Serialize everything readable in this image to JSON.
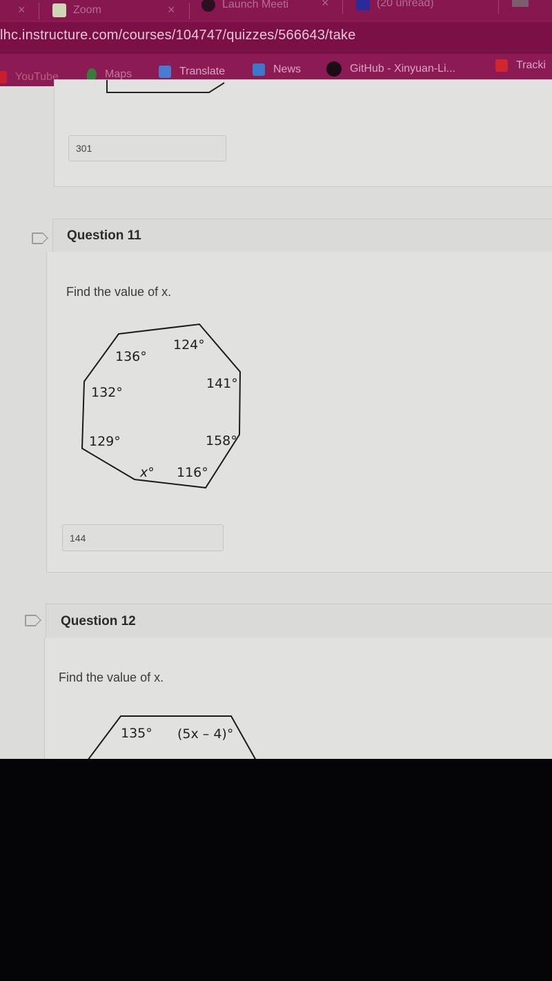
{
  "browser": {
    "tabs": [
      {
        "label": "",
        "close": "×"
      },
      {
        "label": "Zoom",
        "close": "×"
      },
      {
        "label": "Launch Meeti",
        "close": "×"
      },
      {
        "label": "(20 unread)"
      }
    ],
    "url": "lhc.instructure.com/courses/104747/quizzes/566643/take",
    "bookmarks": [
      {
        "label": "YouTube",
        "icon": "youtube-icon"
      },
      {
        "label": "Maps",
        "icon": "maps-icon"
      },
      {
        "label": "Translate",
        "icon": "translate-icon"
      },
      {
        "label": "News",
        "icon": "news-icon"
      },
      {
        "label": "GitHub - Xinyuan-Li...",
        "icon": "github-icon"
      },
      {
        "label": "Tracki",
        "icon": "tracking-icon"
      }
    ]
  },
  "quiz": {
    "previous_question": {
      "answer_value": "301"
    },
    "questions": [
      {
        "title": "Question 11",
        "prompt": "Find the value of x.",
        "figure": {
          "shape": "octagon",
          "angle_labels": [
            "124°",
            "136°",
            "132°",
            "141°",
            "129°",
            "158°",
            "x°",
            "116°"
          ]
        },
        "answer_value": "144"
      },
      {
        "title": "Question 12",
        "prompt": "Find the value of x.",
        "figure": {
          "shape": "polygon",
          "angle_labels": [
            "135°",
            "(5x – 4)°"
          ]
        }
      }
    ]
  },
  "colors": {
    "chrome": "#8c1a55",
    "page_bg": "#dcdcda"
  }
}
